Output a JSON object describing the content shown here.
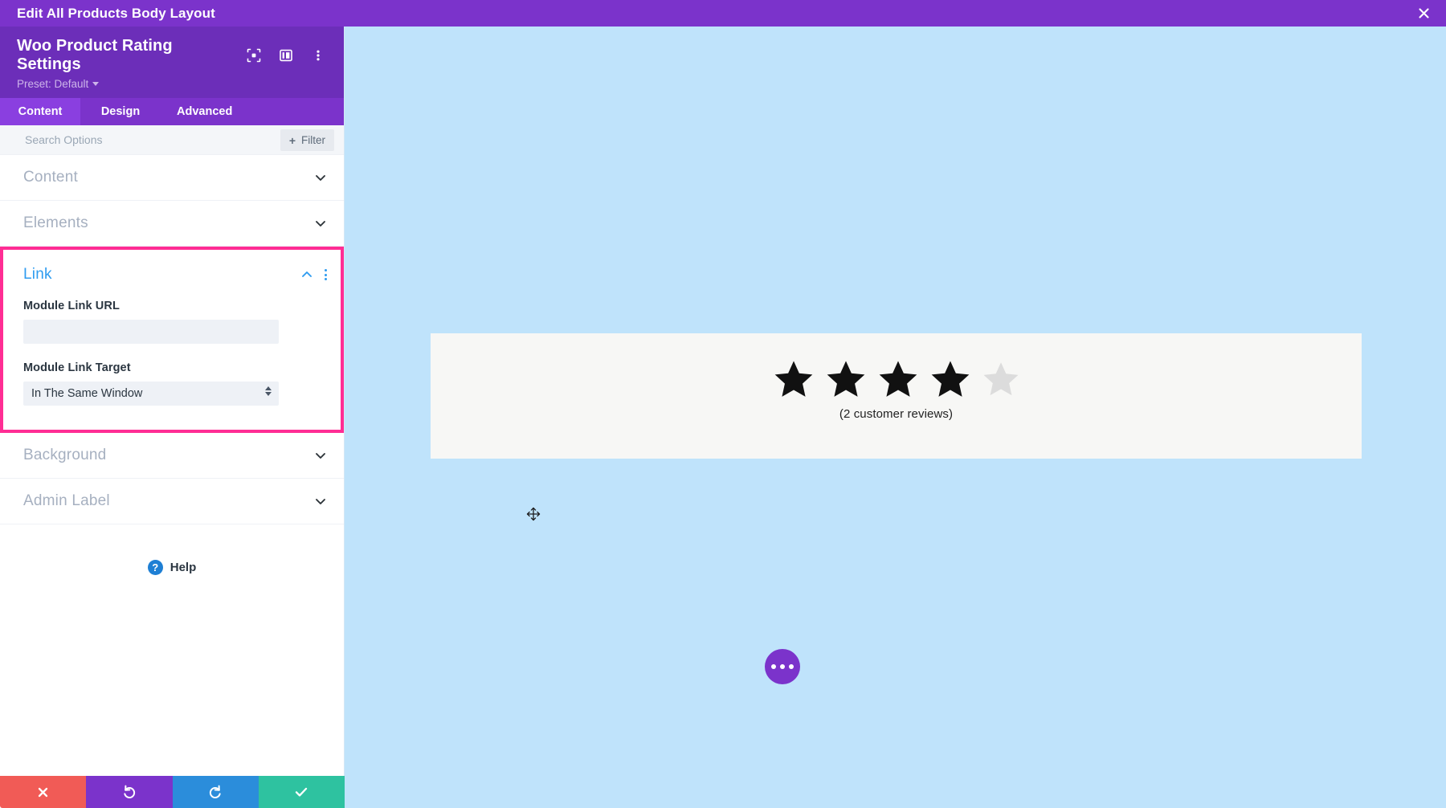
{
  "window": {
    "title": "Edit All Products Body Layout",
    "close_icon": "close-icon"
  },
  "panel": {
    "module_title": "Woo Product Rating Settings",
    "preset_label": "Preset: Default",
    "header_icons": [
      "focus-target-icon",
      "panel-layout-icon",
      "kebab-menu-icon"
    ],
    "tabs": [
      {
        "label": "Content",
        "active": true
      },
      {
        "label": "Design",
        "active": false
      },
      {
        "label": "Advanced",
        "active": false
      }
    ],
    "search": {
      "placeholder": "Search Options",
      "value": ""
    },
    "filter_button": {
      "label": "Filter",
      "plus": "+"
    },
    "sections": [
      {
        "label": "Content",
        "expanded": false
      },
      {
        "label": "Elements",
        "expanded": false
      }
    ],
    "link_section": {
      "title": "Link",
      "expanded": true,
      "highlight_color": "#ff2d94",
      "title_color": "#2f9cf0",
      "fields": {
        "url_label": "Module Link URL",
        "url_value": "",
        "url_placeholder": "",
        "target_label": "Module Link Target",
        "target_value": "In The Same Window"
      }
    },
    "sections_after": [
      {
        "label": "Background",
        "expanded": false
      },
      {
        "label": "Admin Label",
        "expanded": false
      }
    ],
    "help": {
      "label": "Help",
      "badge": "?"
    },
    "actions": [
      {
        "name": "cancel",
        "icon": "close-icon",
        "color": "#f15b56"
      },
      {
        "name": "undo",
        "icon": "undo-icon",
        "color": "#7b33cb"
      },
      {
        "name": "redo",
        "icon": "redo-icon",
        "color": "#2b8ddb"
      },
      {
        "name": "save",
        "icon": "check-icon",
        "color": "#2ec2a0"
      }
    ]
  },
  "preview": {
    "background_color": "#bfe3fb",
    "module_background": "#f7f7f5",
    "rating": {
      "total_stars": 5,
      "filled_stars": 4,
      "filled_color": "#111111",
      "empty_color": "#dcdcdc",
      "reviews_text": "(2 customer reviews)"
    },
    "fab": {
      "icon": "ellipsis-icon",
      "color": "#7b33cb"
    },
    "cursor": "move-cursor-icon"
  }
}
